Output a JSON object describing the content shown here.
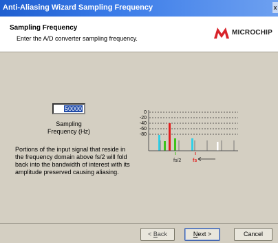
{
  "window": {
    "title": "Anti-Aliasing Wizard Sampling Frequency",
    "edge_char": "x"
  },
  "header": {
    "title": "Sampling Frequency",
    "subtitle": "Enter the A/D converter sampling frequency.",
    "logo_text": "MICROCHIP",
    "logo_icon": "microchip-logo-icon"
  },
  "sampling": {
    "value": "50000",
    "label_line1": "Sampling",
    "label_line2": "Frequency (Hz)"
  },
  "description": "Portions of the input signal that reside in the frequency domain above fs/2 will fold back into the bandwidth of interest with its amplitude preserved causing aliasing.",
  "chart": {
    "y_ticks": [
      "0",
      "-20",
      "-40",
      "-60",
      "-80"
    ],
    "labels": {
      "fs2": "fs/2",
      "fs": "fs"
    },
    "colors": {
      "red": "#e21b1b",
      "green": "#3ec21a",
      "cyan": "#30d0e8",
      "white": "#ffffff",
      "axis": "#555555"
    }
  },
  "buttons": {
    "back": {
      "prefix": "< ",
      "key": "B",
      "rest": "ack"
    },
    "next": {
      "key": "N",
      "rest": "ext >"
    },
    "cancel": "Cancel"
  }
}
